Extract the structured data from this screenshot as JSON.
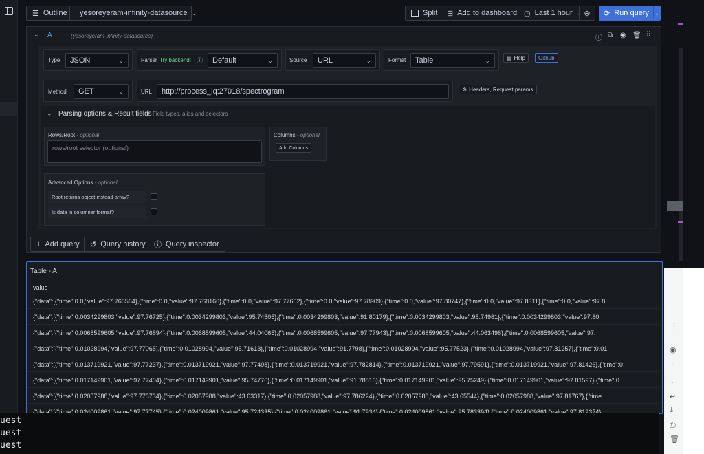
{
  "toolbar": {
    "outline_label": "Outline",
    "datasource_name": "yesoreyeram-infinity-datasource",
    "split_label": "Split",
    "add_dashboard_label": "Add to dashboard",
    "time_range_label": "Last 1 hour",
    "run_query_label": "Run query"
  },
  "query": {
    "ref_id": "A",
    "datasource_hint": "(yesoreyeram-infinity-datasource)",
    "type_label": "Type",
    "type_value": "JSON",
    "parser_label": "Parser",
    "parser_try": "Try backend!",
    "parser_value": "Default",
    "source_label": "Source",
    "source_value": "URL",
    "format_label": "Format",
    "format_value": "Table",
    "help_label": "Help",
    "github_label": "Github",
    "method_label": "Method",
    "method_value": "GET",
    "url_label": "URL",
    "url_value": "http://process_iq:27018/spectrogram",
    "headers_label": "Headers, Request params",
    "parsing_title": "Parsing options & Result fields",
    "parsing_hint": "Field types, alias and selectors",
    "rows_root_label": "Rows/Root",
    "rows_root_optional": "- optional",
    "rows_root_placeholder": "rows/root selector (optional)",
    "columns_label": "Columns",
    "columns_optional": "- optional",
    "add_columns_label": "Add Columns",
    "advanced_label": "Advanced Options",
    "advanced_optional": "- optional",
    "root_object_label": "Root returns object instead array?",
    "columnar_label": "Is data in columnar format?"
  },
  "actions": {
    "add_query": "Add query",
    "query_history": "Query history",
    "query_inspector": "Query inspector"
  },
  "table": {
    "title": "Table - A",
    "column_header": "value",
    "rows": [
      "{\"data\":[{\"time\":0.0,\"value\":97.765564},{\"time\":0.0,\"value\":97.768166},{\"time\":0.0,\"value\":97.77602},{\"time\":0.0,\"value\":97.78909},{\"time\":0.0,\"value\":97.80747},{\"time\":0.0,\"value\":97.8311},{\"time\":0.0,\"value\":97.8",
      "{\"data\":[{\"time\":0.0034299803,\"value\":97.76725},{\"time\":0.0034299803,\"value\":95.74505},{\"time\":0.0034299803,\"value\":91.80179},{\"time\":0.0034299803,\"value\":95.74981},{\"time\":0.0034299803,\"value\":97.80",
      "{\"data\":[{\"time\":0.0068599605,\"value\":97.76894},{\"time\":0.0068599605,\"value\":44.04065},{\"time\":0.0068599605,\"value\":97.77943},{\"time\":0.0068599605,\"value\":44.063496},{\"time\":0.0068599605,\"value\":97.",
      "{\"data\":[{\"time\":0.01028994,\"value\":97.77065},{\"time\":0.01028994,\"value\":95.71613},{\"time\":0.01028994,\"value\":91.7798},{\"time\":0.01028994,\"value\":95.77523},{\"time\":0.01028994,\"value\":97.81257},{\"time\":0.01",
      "{\"data\":[{\"time\":0.013719921,\"value\":97.77237},{\"time\":0.013719921,\"value\":97.77498},{\"time\":0.013719921,\"value\":97.782814},{\"time\":0.013719921,\"value\":97.79591},{\"time\":0.013719921,\"value\":97.81426},{\"time\":0",
      "{\"data\":[{\"time\":0.017149901,\"value\":97.77404},{\"time\":0.017149901,\"value\":95.74776},{\"time\":0.017149901,\"value\":91.78816},{\"time\":0.017149901,\"value\":95.75249},{\"time\":0.017149901,\"value\":97.81597},{\"time\":0",
      "{\"data\":[{\"time\":0.02057988,\"value\":97.775734},{\"time\":0.02057988,\"value\":43.63317},{\"time\":0.02057988,\"value\":97.786224},{\"time\":0.02057988,\"value\":43.65544},{\"time\":0.02057988,\"value\":97.81767},{\"time",
      "{\"data\":[{\"time\":0.024009861,\"value\":97.77745},{\"time\":0.024009861,\"value\":95.724335},{\"time\":0.024009861,\"value\":91.7934},{\"time\":0.024009861,\"value\":95.783394},{\"time\":0.024009861,\"value\":97.819374}"
    ]
  },
  "terminal": {
    "lines": [
      "uest",
      "uest",
      "uest"
    ]
  },
  "colors": {
    "accent": "#3d71d9",
    "background": "#111217",
    "panel": "#181b1f",
    "try_backend": "#6ccf8e",
    "purple_marker": "#a352cc"
  }
}
